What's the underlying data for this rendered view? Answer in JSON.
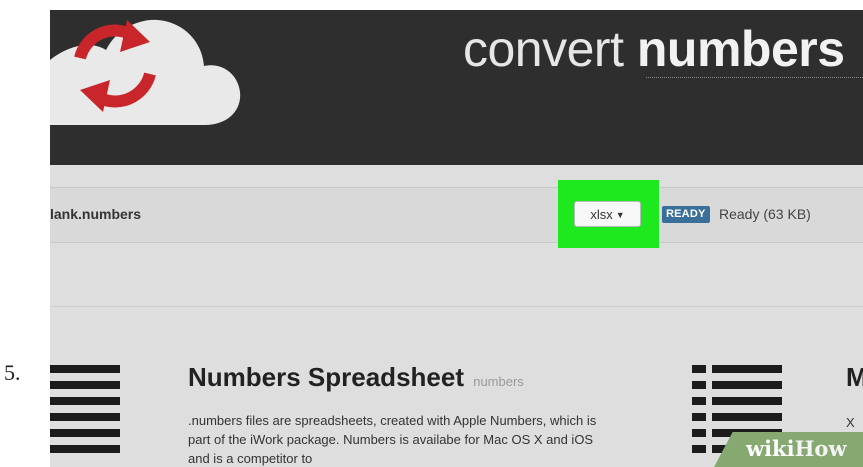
{
  "step": {
    "number": "5."
  },
  "header": {
    "title_light": "convert ",
    "title_bold": "numbers",
    "logo_icon": "refresh-cloud-icon",
    "colors": {
      "logo_red": "#c8262a",
      "cloud": "#e9e9e9",
      "background": "#2e2e2e"
    }
  },
  "file": {
    "name": "lank.numbers",
    "format": {
      "selected": "xlsx",
      "icon": "caret-down-icon"
    },
    "status": {
      "badge": "READY",
      "text": "Ready (63 KB)"
    },
    "colors": {
      "highlight": "#1ee81e",
      "badge": "#3a6f9a"
    }
  },
  "info": {
    "title": "Numbers Spreadsheet",
    "extension": "numbers",
    "description": ".numbers files are spreadsheets, created with Apple Numbers, which is part of the iWork package. Numbers is availabe for Mac OS X and iOS and is a competitor to",
    "left_icon": "document-lines-icon",
    "right_icon": "list-icon",
    "right_heading": "M",
    "right_desc": "X"
  },
  "watermark": {
    "text_wiki": "wiki",
    "text_how": "How"
  }
}
